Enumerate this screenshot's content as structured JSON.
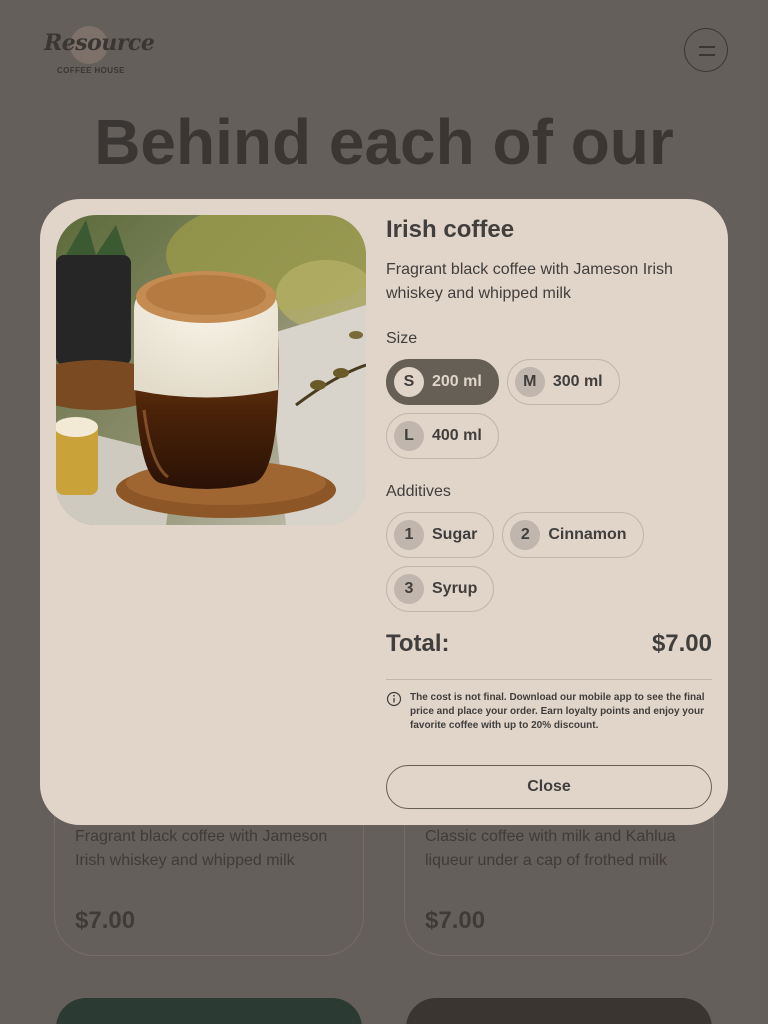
{
  "brand": {
    "logo_text": "Resource",
    "logo_sub": "COFFEE HOUSE"
  },
  "header": {
    "menu_icon": "burger-menu-icon"
  },
  "background": {
    "heading": "Behind each of our",
    "cards": [
      {
        "description": "Fragrant black coffee with Jameson Irish whiskey and whipped milk",
        "price": "$7.00"
      },
      {
        "description": "Classic coffee with milk and Kahlua liqueur under a cap of frothed milk",
        "price": "$7.00"
      }
    ]
  },
  "modal": {
    "title": "Irish coffee",
    "description": "Fragrant black coffee with Jameson Irish whiskey and whipped milk",
    "size_label": "Size",
    "sizes": [
      {
        "badge": "S",
        "label": "200 ml",
        "selected": true
      },
      {
        "badge": "M",
        "label": "300 ml",
        "selected": false
      },
      {
        "badge": "L",
        "label": "400 ml",
        "selected": false
      }
    ],
    "additives_label": "Additives",
    "additives": [
      {
        "badge": "1",
        "label": "Sugar",
        "selected": false
      },
      {
        "badge": "2",
        "label": "Cinnamon",
        "selected": false
      },
      {
        "badge": "3",
        "label": "Syrup",
        "selected": false
      }
    ],
    "total_label": "Total:",
    "total_value": "$7.00",
    "note": "The cost is not final. Download our mobile app to see the final price and place your order. Earn loyalty points and enjoy your favorite coffee with up to 20% discount.",
    "note_icon": "info-icon",
    "close_label": "Close"
  },
  "colors": {
    "overlay": "#655f5b",
    "modal_bg": "#e1d4c9",
    "accent": "#665f55",
    "border": "#c1b6ad",
    "text": "#403f3d"
  }
}
